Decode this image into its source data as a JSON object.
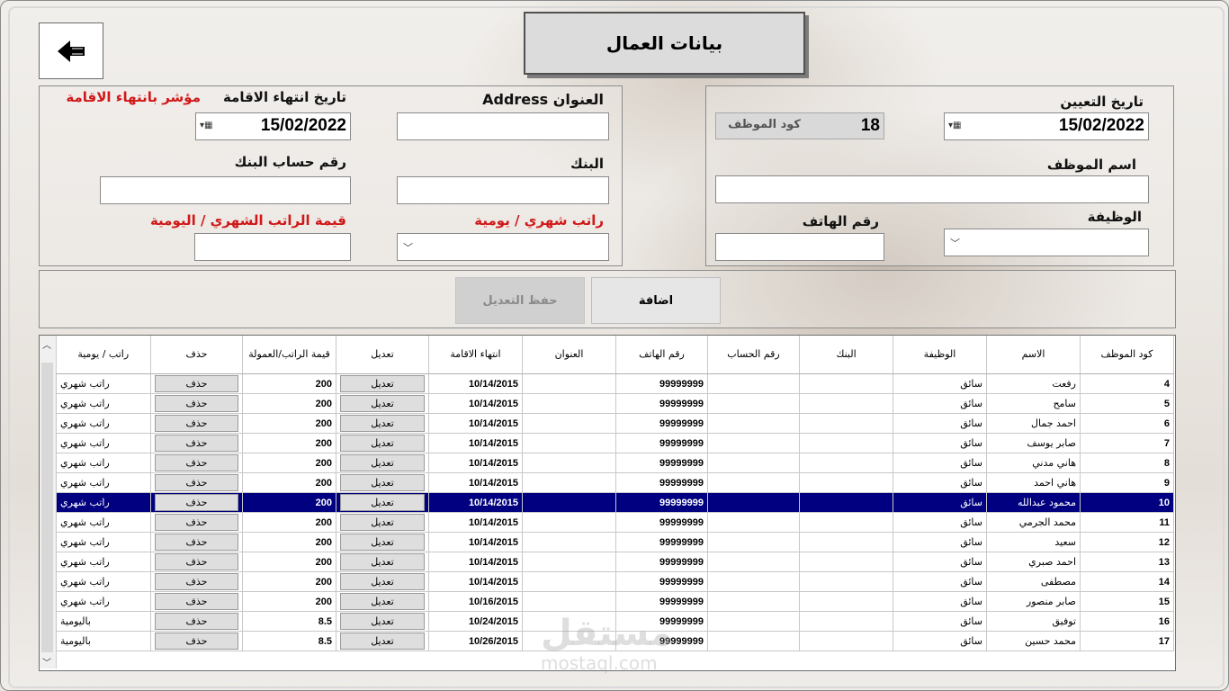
{
  "window": {
    "title": "بيانات العمال"
  },
  "header": {
    "back_icon": "back-arrow-icon"
  },
  "right_form": {
    "hire_date_label": "تاريخ التعيين",
    "hire_date_value": "15/02/2022",
    "emp_code_label": "كود الموظف",
    "emp_code_value": "18",
    "emp_name_label": "اسم الموظف",
    "emp_name_value": "",
    "job_label": "الوظيفة",
    "job_value": "",
    "phone_label": "رقم الهاتف",
    "phone_value": ""
  },
  "left_form": {
    "address_label": "العنوان Address",
    "address_value": "",
    "residency_end_label": "تاريخ انتهاء الاقامة",
    "residency_end_value": "15/02/2022",
    "residency_indicator_label": "مؤشر بانتهاء الاقامة",
    "bank_label": "البنك",
    "bank_value": "",
    "bank_account_label": "رقم حساب البنك",
    "bank_account_value": "",
    "salary_type_label": "راتب شهري / يومية",
    "salary_type_value": "",
    "salary_value_label": "قيمة الراتب الشهري / اليومية",
    "salary_value_value": ""
  },
  "actions": {
    "add_label": "اضافة",
    "save_edit_label": "حفظ التعديل"
  },
  "table": {
    "columns": [
      "كود الموظف",
      "الاسم",
      "الوظيفة",
      "البنك",
      "رقم الحساب",
      "رقم الهاتف",
      "العنوان",
      "انتهاء الاقامة",
      "تعديل",
      "قيمة الراتب/العمولة",
      "حذف",
      "راتب / يومية"
    ],
    "edit_label": "تعديل",
    "delete_label": "حذف",
    "selected_row_index": 6,
    "rows": [
      {
        "code": "4",
        "name": "رفعت",
        "job": "سائق",
        "bank": "",
        "account": "",
        "phone": "99999999",
        "address": "",
        "residency_end": "10/14/2015",
        "value": "200",
        "type": "راتب شهري"
      },
      {
        "code": "5",
        "name": "سامح",
        "job": "سائق",
        "bank": "",
        "account": "",
        "phone": "99999999",
        "address": "",
        "residency_end": "10/14/2015",
        "value": "200",
        "type": "راتب شهري"
      },
      {
        "code": "6",
        "name": "احمد جمال",
        "job": "سائق",
        "bank": "",
        "account": "",
        "phone": "99999999",
        "address": "",
        "residency_end": "10/14/2015",
        "value": "200",
        "type": "راتب شهري"
      },
      {
        "code": "7",
        "name": "صابر يوسف",
        "job": "سائق",
        "bank": "",
        "account": "",
        "phone": "99999999",
        "address": "",
        "residency_end": "10/14/2015",
        "value": "200",
        "type": "راتب شهري"
      },
      {
        "code": "8",
        "name": "هاني مدني",
        "job": "سائق",
        "bank": "",
        "account": "",
        "phone": "99999999",
        "address": "",
        "residency_end": "10/14/2015",
        "value": "200",
        "type": "راتب شهري"
      },
      {
        "code": "9",
        "name": "هاني احمد",
        "job": "سائق",
        "bank": "",
        "account": "",
        "phone": "99999999",
        "address": "",
        "residency_end": "10/14/2015",
        "value": "200",
        "type": "راتب شهري"
      },
      {
        "code": "10",
        "name": "محمود عبدالله",
        "job": "سائق",
        "bank": "",
        "account": "",
        "phone": "99999999",
        "address": "",
        "residency_end": "10/14/2015",
        "value": "200",
        "type": "راتب شهري"
      },
      {
        "code": "11",
        "name": "محمد الجرمي",
        "job": "سائق",
        "bank": "",
        "account": "",
        "phone": "99999999",
        "address": "",
        "residency_end": "10/14/2015",
        "value": "200",
        "type": "راتب شهري"
      },
      {
        "code": "12",
        "name": "سعيد",
        "job": "سائق",
        "bank": "",
        "account": "",
        "phone": "99999999",
        "address": "",
        "residency_end": "10/14/2015",
        "value": "200",
        "type": "راتب شهري"
      },
      {
        "code": "13",
        "name": "احمد صبري",
        "job": "سائق",
        "bank": "",
        "account": "",
        "phone": "99999999",
        "address": "",
        "residency_end": "10/14/2015",
        "value": "200",
        "type": "راتب شهري"
      },
      {
        "code": "14",
        "name": "مصطفى",
        "job": "سائق",
        "bank": "",
        "account": "",
        "phone": "99999999",
        "address": "",
        "residency_end": "10/14/2015",
        "value": "200",
        "type": "راتب شهري"
      },
      {
        "code": "15",
        "name": "صابر منصور",
        "job": "سائق",
        "bank": "",
        "account": "",
        "phone": "99999999",
        "address": "",
        "residency_end": "10/16/2015",
        "value": "200",
        "type": "راتب شهري"
      },
      {
        "code": "16",
        "name": "توفيق",
        "job": "سائق",
        "bank": "",
        "account": "",
        "phone": "99999999",
        "address": "",
        "residency_end": "10/24/2015",
        "value": "8.5",
        "type": "باليومية"
      },
      {
        "code": "17",
        "name": "محمد حسين",
        "job": "سائق",
        "bank": "",
        "account": "",
        "phone": "99999999",
        "address": "",
        "residency_end": "10/26/2015",
        "value": "8.5",
        "type": "باليومية"
      }
    ]
  },
  "watermark": {
    "arabic": "مستقل",
    "latin": "mostaql.com"
  },
  "colors": {
    "selected_row": "#000080",
    "red_label": "#d01818"
  }
}
